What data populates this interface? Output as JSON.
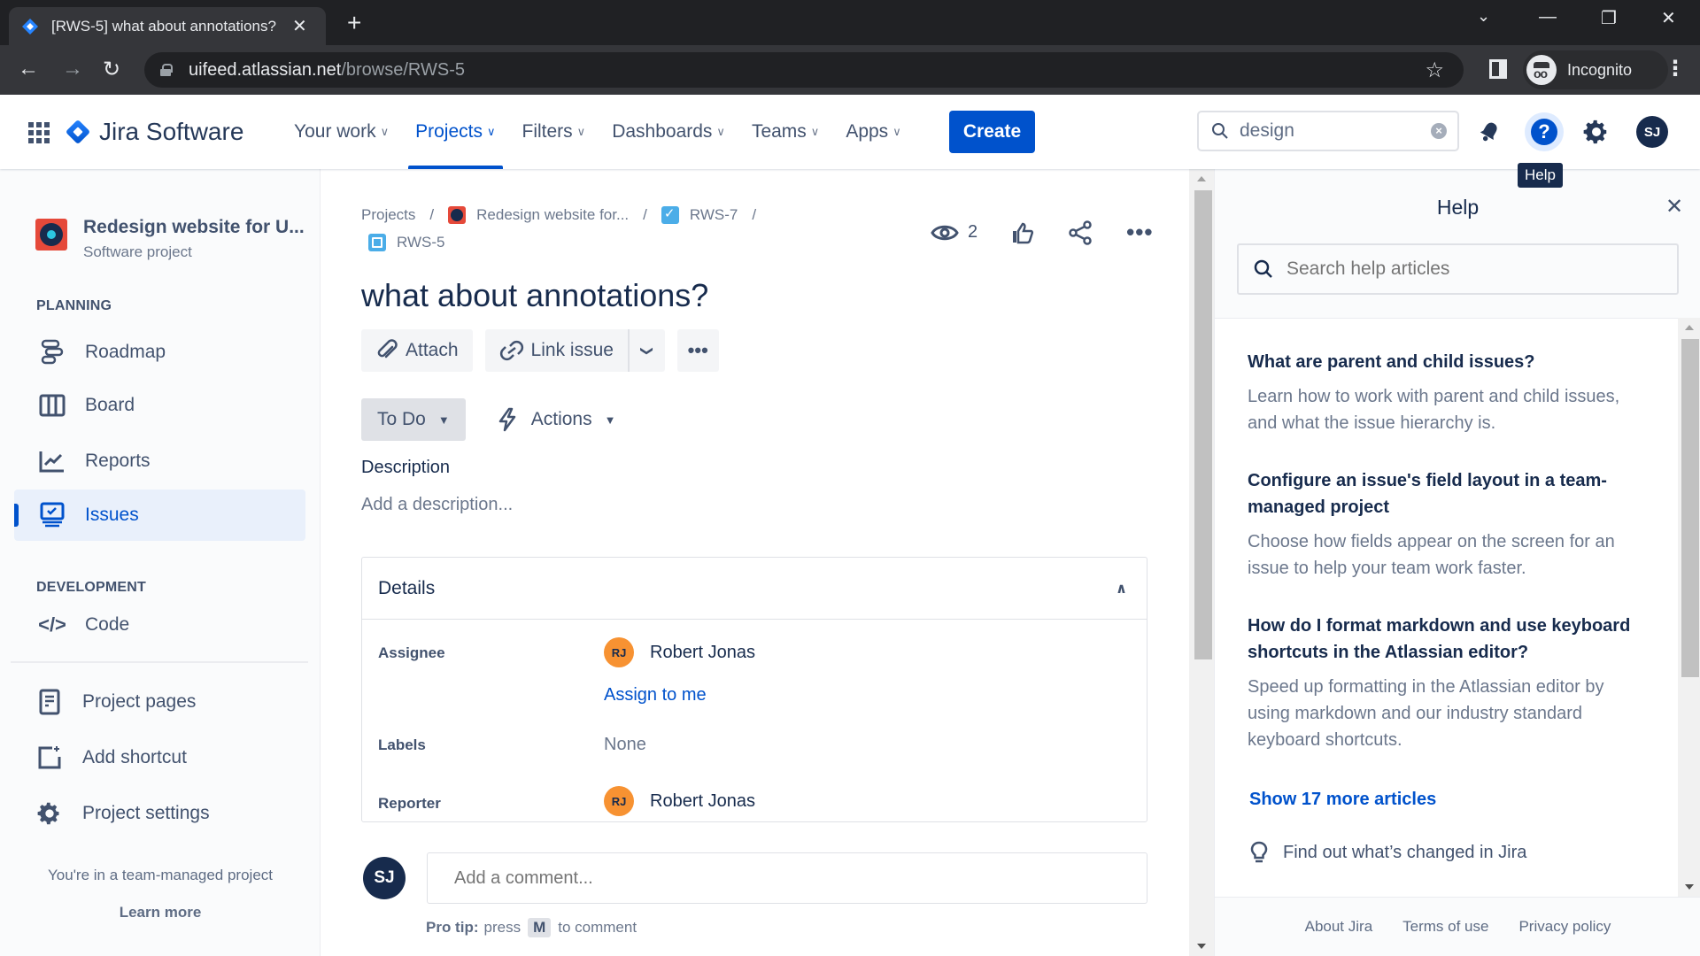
{
  "browser": {
    "tab_title": "[RWS-5] what about annotations?",
    "url_host": "uifeed.atlassian.net",
    "url_path": "/browse/RWS-5",
    "profile_label": "Incognito"
  },
  "topnav": {
    "product_name": "Jira Software",
    "items": [
      {
        "label": "Your work",
        "active": false
      },
      {
        "label": "Projects",
        "active": true
      },
      {
        "label": "Filters",
        "active": false
      },
      {
        "label": "Dashboards",
        "active": false
      },
      {
        "label": "Teams",
        "active": false
      },
      {
        "label": "Apps",
        "active": false
      }
    ],
    "create_label": "Create",
    "search_value": "design",
    "avatar_initials": "SJ",
    "help_tooltip": "Help"
  },
  "sidebar": {
    "project_name": "Redesign website for U...",
    "project_type": "Software project",
    "planning_label": "PLANNING",
    "planning_items": [
      {
        "label": "Roadmap"
      },
      {
        "label": "Board"
      },
      {
        "label": "Reports"
      },
      {
        "label": "Issues",
        "active": true
      }
    ],
    "development_label": "DEVELOPMENT",
    "development_items": [
      {
        "label": "Code"
      }
    ],
    "other_items": [
      {
        "label": "Project pages"
      },
      {
        "label": "Add shortcut"
      },
      {
        "label": "Project settings"
      }
    ],
    "footer_text": "You're in a team-managed project",
    "learn_more": "Learn more"
  },
  "issue": {
    "breadcrumb": {
      "projects": "Projects",
      "project": "Redesign website for...",
      "parent": "RWS-7",
      "current": "RWS-5",
      "separator": "/"
    },
    "watchers_count": "2",
    "title": "what about annotations?",
    "toolbar": {
      "attach": "Attach",
      "link_issue": "Link issue"
    },
    "status": "To Do",
    "actions_label": "Actions",
    "description_label": "Description",
    "description_placeholder": "Add a description...",
    "details": {
      "title": "Details",
      "assignee_label": "Assignee",
      "assignee_name": "Robert Jonas",
      "assignee_initials": "RJ",
      "assign_to_me": "Assign to me",
      "labels_label": "Labels",
      "labels_value": "None",
      "reporter_label": "Reporter",
      "reporter_name": "Robert Jonas",
      "reporter_initials": "RJ"
    },
    "comment": {
      "avatar_initials": "SJ",
      "placeholder": "Add a comment...",
      "pro_tip_label": "Pro tip:",
      "pro_tip_pre": "press",
      "pro_tip_key": "M",
      "pro_tip_post": "to comment"
    }
  },
  "help": {
    "title": "Help",
    "search_placeholder": "Search help articles",
    "articles": [
      {
        "title": "What are parent and child issues?",
        "desc": "Learn how to work with parent and child issues, and what the issue hierarchy is."
      },
      {
        "title": "Configure an issue's field layout in a team-managed project",
        "desc": "Choose how fields appear on the screen for an issue to help your team work faster."
      },
      {
        "title": "How do I format markdown and use keyboard shortcuts in the Atlassian editor?",
        "desc": "Speed up formatting in the Atlassian editor by using markdown and our industry standard keyboard shortcuts."
      }
    ],
    "show_more": "Show 17 more articles",
    "whats_new": "Find out what’s changed in Jira",
    "footer": [
      "About Jira",
      "Terms of use",
      "Privacy policy"
    ]
  },
  "colors": {
    "brand": "#0052cc",
    "avatar_orange": "#f79232",
    "avatar_dark": "#172b4d"
  }
}
